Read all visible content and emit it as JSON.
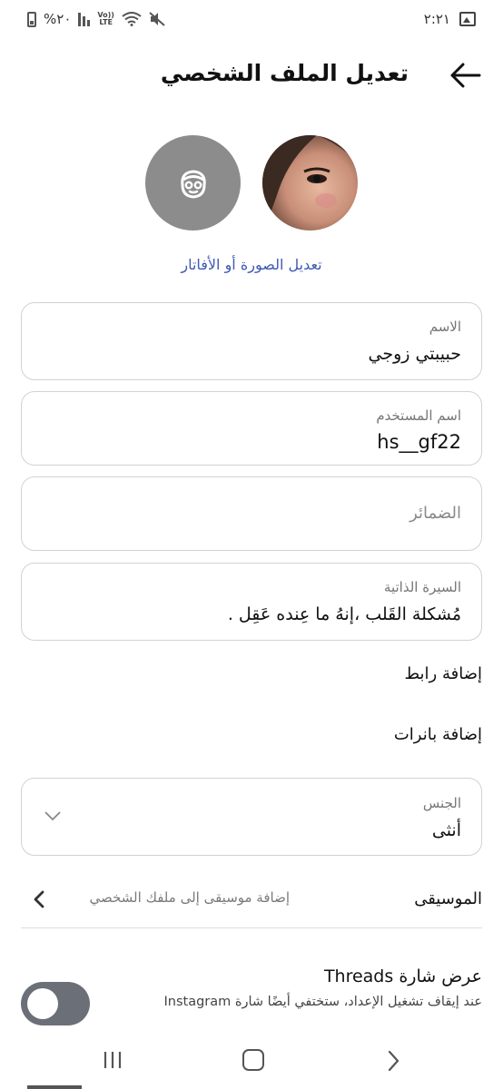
{
  "status_bar": {
    "battery_percent": "%٢٠",
    "volte_top": "Vo))",
    "volte_bottom": "LTE",
    "time": "٢:٢١"
  },
  "header": {
    "title": "تعديل الملف الشخصي"
  },
  "profile": {
    "edit_photo_label": "تعديل الصورة أو الأفاتار"
  },
  "fields": {
    "name": {
      "label": "الاسم",
      "value": "حبيبتي زوجي"
    },
    "username": {
      "label": "اسم المستخدم",
      "value": "hs__gf22"
    },
    "pronouns": {
      "placeholder": "الضمائر"
    },
    "bio": {
      "label": "السيرة الذاتية",
      "value": "مُشكلة القَلب ،إنهُ ما عِنده عَقِل ."
    },
    "gender": {
      "label": "الجنس",
      "value": "أنثى"
    }
  },
  "links": {
    "add_link": "إضافة رابط",
    "add_banners": "إضافة بانرات"
  },
  "music": {
    "label": "الموسيقى",
    "hint": "إضافة موسيقى إلى ملفك الشخصي"
  },
  "threads": {
    "title": "عرض شارة Threads",
    "description": "عند إيقاف تشغيل الإعداد، ستختفي أيضًا شارة Instagram",
    "toggle_on": false
  },
  "colors": {
    "accent_link": "#3f5ab5",
    "toggle_off": "#6b6f78",
    "avatar_generic_bg": "#8c8c8c"
  }
}
